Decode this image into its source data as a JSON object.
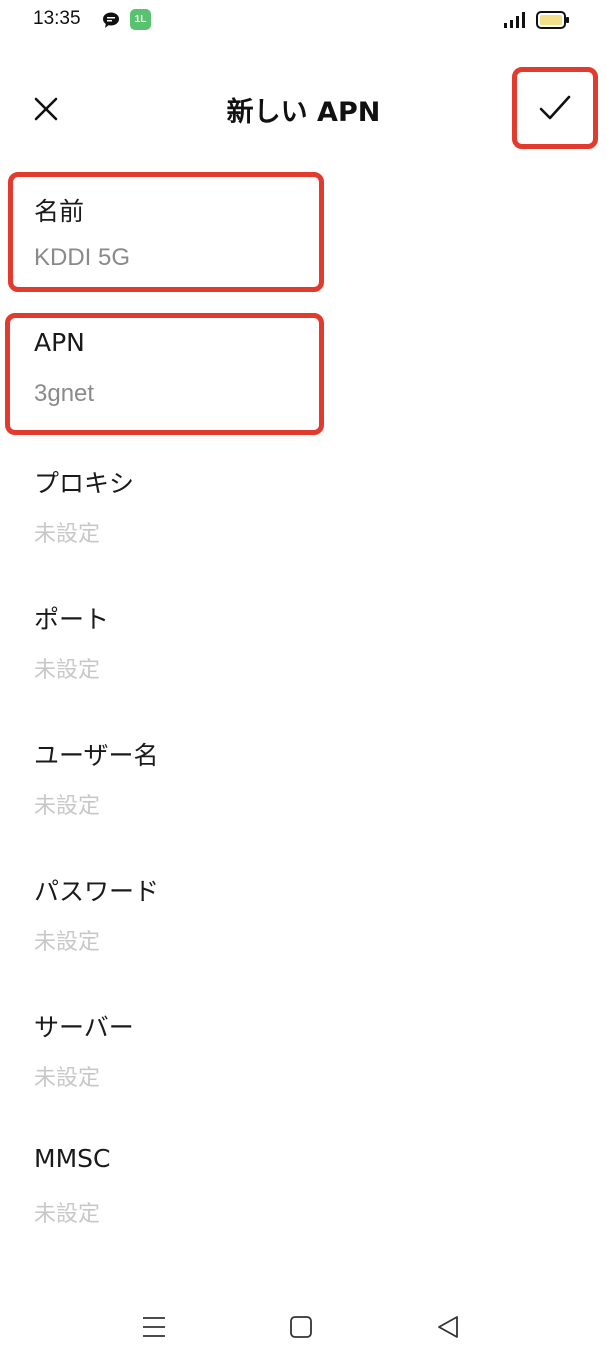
{
  "status_bar": {
    "time": "13:35",
    "app_icon_text": "1L",
    "icons": [
      "chat-bubble-icon",
      "app-notification-icon",
      "signal-icon",
      "battery-icon"
    ],
    "battery_color": "#f5e08a"
  },
  "header": {
    "title": "新しい APN",
    "close_icon": "close-icon",
    "confirm_icon": "checkmark-icon"
  },
  "fields": [
    {
      "key": "name",
      "label": "名前",
      "value": "KDDI 5G"
    },
    {
      "key": "apn",
      "label": "APN",
      "value": "3gnet"
    },
    {
      "key": "proxy",
      "label": "プロキシ",
      "value": "未設定"
    },
    {
      "key": "port",
      "label": "ポート",
      "value": "未設定"
    },
    {
      "key": "username",
      "label": "ユーザー名",
      "value": "未設定"
    },
    {
      "key": "password",
      "label": "パスワード",
      "value": "未設定"
    },
    {
      "key": "server",
      "label": "サーバー",
      "value": "未設定"
    },
    {
      "key": "mmsc",
      "label": "MMSC",
      "value": "未設定"
    }
  ],
  "colors": {
    "highlight": "#e23b2e",
    "unset_value": "#c8c8c8",
    "set_value": "#8a8a8a"
  },
  "nav_bar": {
    "icons": [
      "menu-icon",
      "home-icon",
      "back-icon"
    ]
  }
}
